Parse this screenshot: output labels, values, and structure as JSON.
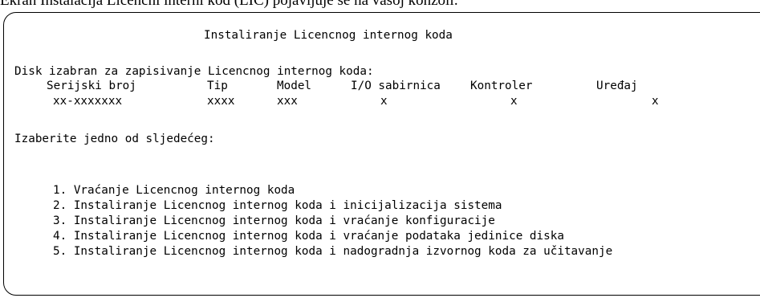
{
  "intro_text": "Ekran Instalacija Licencni interni kod (LIC) pojavljuje se na vašoj konzoli:",
  "screen": {
    "title": "Instaliranje Licencnog internog koda",
    "disk_label": "Disk izabran za zapisivanje Licencnog internog koda:",
    "columns": [
      "Serijski broj",
      "Tip",
      "Model",
      "I/O sabirnica",
      "Kontroler",
      "Uređaj"
    ],
    "values": [
      "xx-xxxxxxx",
      "xxxx",
      "xxx",
      "x",
      "x",
      "x"
    ],
    "prompt": "Izaberite jedno od sljedećeg:",
    "options": [
      "1. Vraćanje Licencnog internog koda",
      "2. Instaliranje Licencnog internog koda i inicijalizacija sistema",
      "3. Instaliranje Licencnog internog koda i vraćanje konfiguracije",
      "4. Instaliranje Licencnog internog koda i vraćanje podataka jedinice diska",
      "5. Instaliranje Licencnog internog koda i nadogradnja izvornog koda za učitavanje"
    ]
  }
}
